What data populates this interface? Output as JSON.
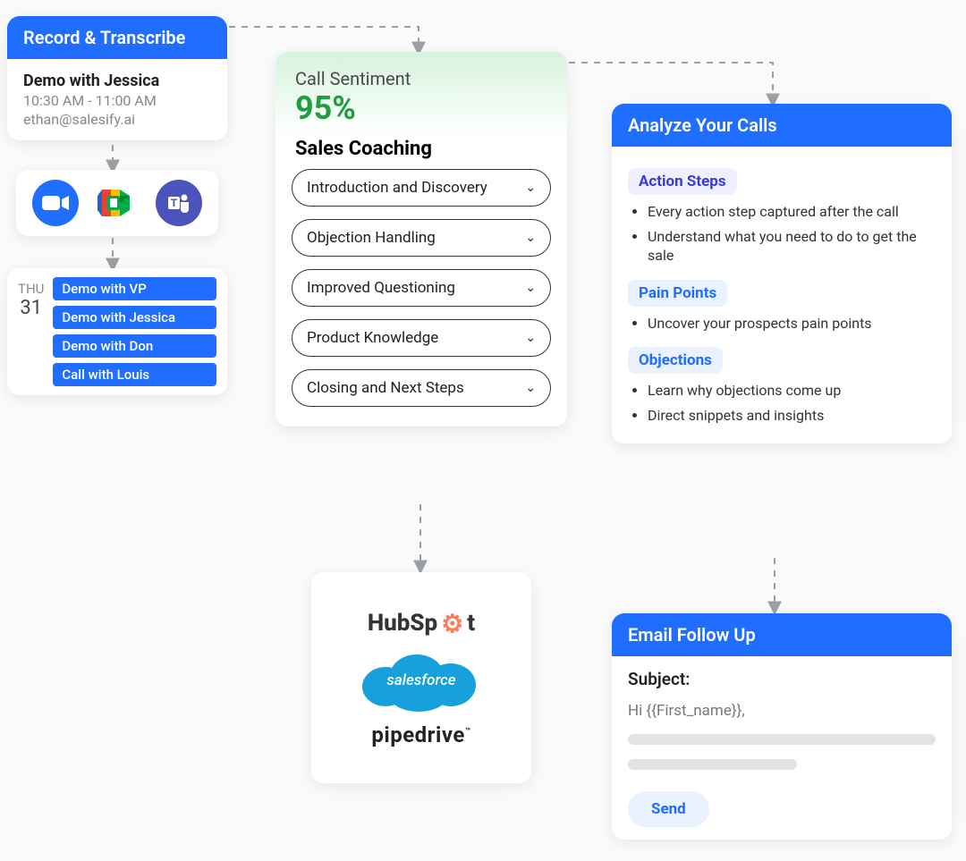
{
  "record": {
    "header": "Record & Transcribe",
    "meeting_title": "Demo with Jessica",
    "meeting_time": "10:30 AM - 11:00 AM",
    "meeting_email": "ethan@salesify.ai"
  },
  "platforms": {
    "zoom": "zoom-icon",
    "meet": "google-meet-icon",
    "teams": "ms-teams-icon"
  },
  "calendar": {
    "day_label": "THU",
    "day_num": "31",
    "events": [
      "Demo with VP",
      "Demo with Jessica",
      "Demo with Don",
      "Call with Louis"
    ]
  },
  "coaching": {
    "sentiment_label": "Call Sentiment",
    "sentiment_value": "95%",
    "title": "Sales Coaching",
    "items": [
      "Introduction and Discovery",
      "Objection Handling",
      "Improved Questioning",
      "Product Knowledge",
      "Closing and Next Steps"
    ]
  },
  "integrations": {
    "hubspot": "HubSp",
    "hubspot_suffix": "t",
    "salesforce": "salesforce",
    "pipedrive": "pipedrive"
  },
  "analyze": {
    "header": "Analyze Your Calls",
    "sections": [
      {
        "label": "Action Steps",
        "style": "purple",
        "bullets": [
          "Every action step captured after the call",
          "Understand what you need to do to get the sale"
        ]
      },
      {
        "label": "Pain Points",
        "style": "blue",
        "bullets": [
          "Uncover your prospects pain points"
        ]
      },
      {
        "label": "Objections",
        "style": "blue",
        "bullets": [
          "Learn why objections come up",
          "Direct snippets and insights"
        ]
      }
    ]
  },
  "email": {
    "header": "Email Follow Up",
    "subject_label": "Subject:",
    "greeting": "Hi {{First_name}},",
    "send": "Send"
  }
}
